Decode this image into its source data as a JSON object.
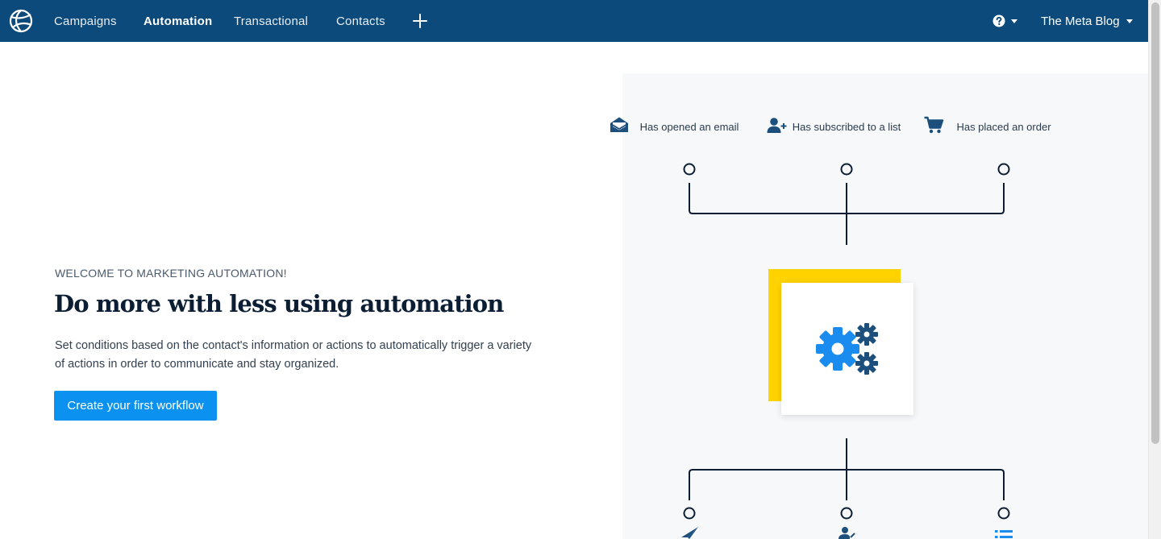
{
  "nav": {
    "items": [
      {
        "label": "Campaigns"
      },
      {
        "label": "Automation"
      },
      {
        "label": "Transactional"
      },
      {
        "label": "Contacts"
      }
    ],
    "account_name": "The Meta Blog"
  },
  "main": {
    "eyebrow": "WELCOME TO MARKETING AUTOMATION!",
    "headline": "Do more with less using automation",
    "description": "Set conditions based on the contact's information or actions to automatically trigger a variety of actions in order to communicate and stay organized.",
    "cta_label": "Create your first workflow"
  },
  "illustration": {
    "triggers": [
      {
        "label": "Has opened an email",
        "icon": "open-envelope-icon"
      },
      {
        "label": "Has subscribed to a list",
        "icon": "user-plus-icon"
      },
      {
        "label": "Has placed an order",
        "icon": "shopping-cart-icon"
      }
    ],
    "actions": [
      {
        "icon": "paper-plane-icon"
      },
      {
        "icon": "user-edit-icon"
      },
      {
        "icon": "list-icon"
      }
    ]
  },
  "colors": {
    "nav_bg": "#0b4a7a",
    "accent_blue": "#0b92f0",
    "yellow": "#ffd200",
    "icon_navy": "#1d4f7d"
  }
}
